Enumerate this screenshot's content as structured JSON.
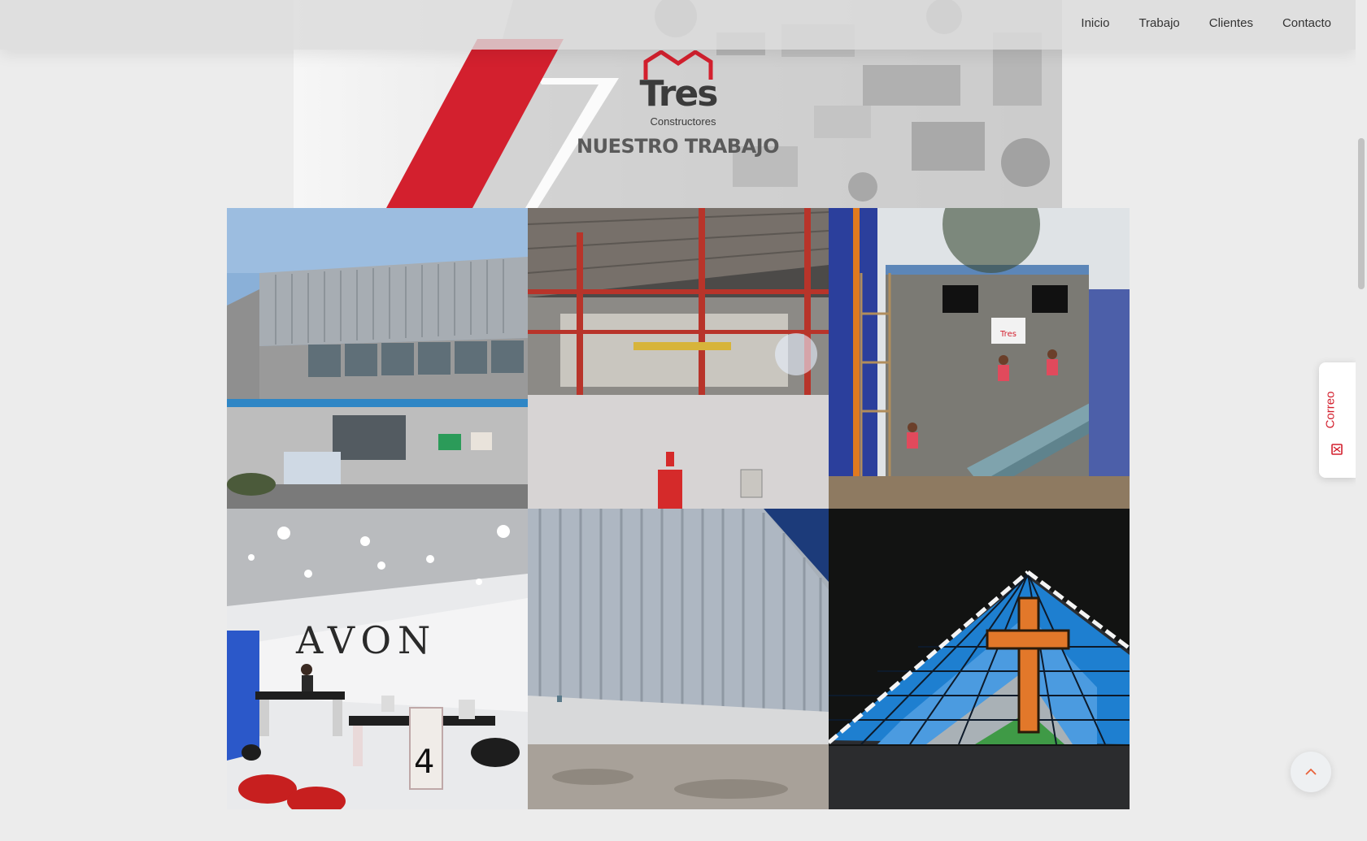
{
  "nav": {
    "items": [
      {
        "label": "Inicio"
      },
      {
        "label": "Trabajo"
      },
      {
        "label": "Clientes"
      },
      {
        "label": "Contacto"
      }
    ]
  },
  "hero": {
    "logo_word": "Tres",
    "logo_subtitle": "Constructores",
    "title": "NUESTRO TRABAJO"
  },
  "gallery": {
    "items": [
      {
        "icon": "building-photo"
      },
      {
        "icon": "warehouse-interior-photo"
      },
      {
        "icon": "construction-site-photo"
      },
      {
        "icon": "office-reception-photo",
        "sign_text": "AVON"
      },
      {
        "icon": "metal-wall-photo"
      },
      {
        "icon": "stained-glass-cross-photo"
      }
    ]
  },
  "side_tab": {
    "label": "Correo",
    "icon": "mail-icon"
  },
  "back_to_top": {
    "icon": "chevron-up-icon"
  },
  "colors": {
    "accent": "#d3202e",
    "text": "#333333",
    "navbar_bg": "#dcdcdc"
  }
}
